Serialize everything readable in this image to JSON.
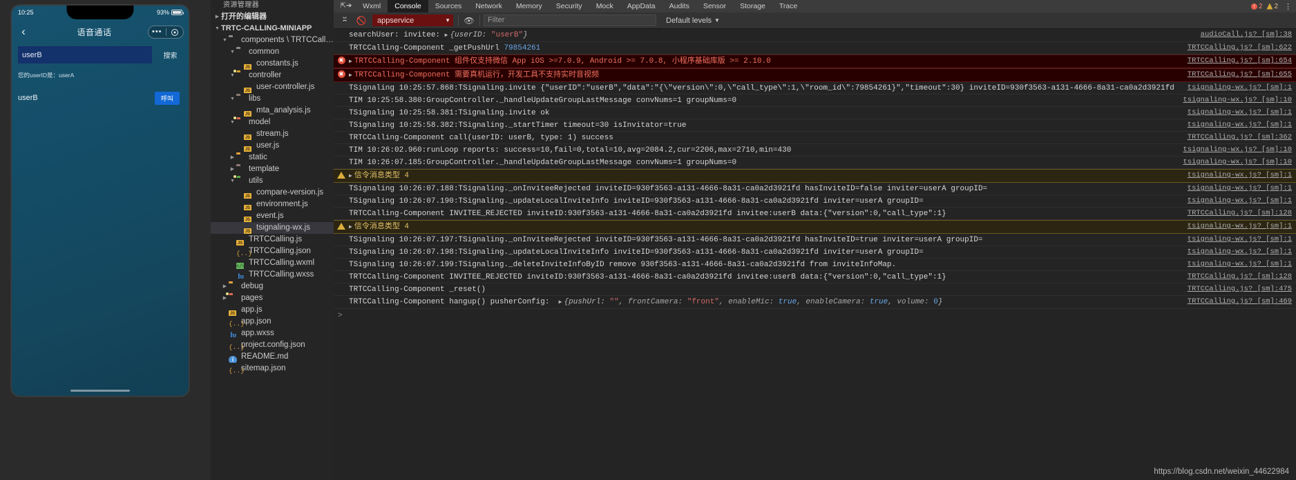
{
  "simulator": {
    "status_time": "10:25",
    "battery_percent": "93%",
    "nav": {
      "back_icon": "chevron-left",
      "title": "语音通话",
      "dots": "•••",
      "capsule_circle": "circle-icon"
    },
    "search": {
      "value": "userB",
      "button_label": "搜索"
    },
    "userid_line": "您的userID是：userA",
    "callee": {
      "name": "userB",
      "call_button_label": "呼叫"
    }
  },
  "explorer": {
    "title": "资源管理器",
    "tree": [
      {
        "indent": 0,
        "twisty": "collapsed",
        "icon": "none",
        "label": "打开的编辑器",
        "bold": true,
        "selected": false
      },
      {
        "indent": 0,
        "twisty": "expanded",
        "icon": "none",
        "label": "TRTC-CALLING-MINIAPP",
        "bold": true,
        "selected": false
      },
      {
        "indent": 1,
        "twisty": "expanded",
        "icon": "folder-gray",
        "label": "components \\ TRTCCalling",
        "selected": false
      },
      {
        "indent": 2,
        "twisty": "expanded",
        "icon": "folder-gray",
        "label": "common",
        "selected": false
      },
      {
        "indent": 3,
        "twisty": "none",
        "icon": "js",
        "label": "constants.js",
        "selected": false
      },
      {
        "indent": 2,
        "twisty": "expanded",
        "icon": "folder-yellow-badge",
        "label": "controller",
        "selected": false
      },
      {
        "indent": 3,
        "twisty": "none",
        "icon": "js",
        "label": "user-controller.js",
        "selected": false
      },
      {
        "indent": 2,
        "twisty": "expanded",
        "icon": "folder-purple",
        "label": "libs",
        "selected": false
      },
      {
        "indent": 3,
        "twisty": "none",
        "icon": "js",
        "label": "mta_analysis.js",
        "selected": false
      },
      {
        "indent": 2,
        "twisty": "expanded",
        "icon": "folder-red-badge",
        "label": "model",
        "selected": false
      },
      {
        "indent": 3,
        "twisty": "none",
        "icon": "js",
        "label": "stream.js",
        "selected": false
      },
      {
        "indent": 3,
        "twisty": "none",
        "icon": "js",
        "label": "user.js",
        "selected": false
      },
      {
        "indent": 2,
        "twisty": "collapsed",
        "icon": "folder-orange",
        "label": "static",
        "selected": false
      },
      {
        "indent": 2,
        "twisty": "collapsed",
        "icon": "folder-purple",
        "label": "template",
        "selected": false
      },
      {
        "indent": 2,
        "twisty": "expanded",
        "icon": "folder-green-badge",
        "label": "utils",
        "selected": false
      },
      {
        "indent": 3,
        "twisty": "none",
        "icon": "js",
        "label": "compare-version.js",
        "selected": false
      },
      {
        "indent": 3,
        "twisty": "none",
        "icon": "js",
        "label": "environment.js",
        "selected": false
      },
      {
        "indent": 3,
        "twisty": "none",
        "icon": "js",
        "label": "event.js",
        "selected": false
      },
      {
        "indent": 3,
        "twisty": "none",
        "icon": "js",
        "label": "tsignaling-wx.js",
        "selected": true
      },
      {
        "indent": 2,
        "twisty": "none",
        "icon": "js",
        "label": "TRTCCalling.js",
        "selected": false
      },
      {
        "indent": 2,
        "twisty": "none",
        "icon": "json",
        "label": "TRTCCalling.json",
        "selected": false
      },
      {
        "indent": 2,
        "twisty": "none",
        "icon": "wxml",
        "label": "TRTCCalling.wxml",
        "selected": false
      },
      {
        "indent": 2,
        "twisty": "none",
        "icon": "wxss",
        "label": "TRTCCalling.wxss",
        "selected": false
      },
      {
        "indent": 1,
        "twisty": "collapsed",
        "icon": "folder-orange",
        "label": "debug",
        "selected": false
      },
      {
        "indent": 1,
        "twisty": "collapsed",
        "icon": "folder-red-badge",
        "label": "pages",
        "selected": false
      },
      {
        "indent": 1,
        "twisty": "none",
        "icon": "js",
        "label": "app.js",
        "selected": false
      },
      {
        "indent": 1,
        "twisty": "none",
        "icon": "json",
        "label": "app.json",
        "selected": false
      },
      {
        "indent": 1,
        "twisty": "none",
        "icon": "wxss",
        "label": "app.wxss",
        "selected": false
      },
      {
        "indent": 1,
        "twisty": "none",
        "icon": "json",
        "label": "project.config.json",
        "selected": false
      },
      {
        "indent": 1,
        "twisty": "none",
        "icon": "md",
        "label": "README.md",
        "selected": false
      },
      {
        "indent": 1,
        "twisty": "none",
        "icon": "json",
        "label": "sitemap.json",
        "selected": false
      }
    ]
  },
  "devtools": {
    "tabs": [
      {
        "label": "Wxml",
        "active": false
      },
      {
        "label": "Console",
        "active": true
      },
      {
        "label": "Sources",
        "active": false
      },
      {
        "label": "Network",
        "active": false
      },
      {
        "label": "Memory",
        "active": false
      },
      {
        "label": "Security",
        "active": false
      },
      {
        "label": "Mock",
        "active": false
      },
      {
        "label": "AppData",
        "active": false
      },
      {
        "label": "Audits",
        "active": false
      },
      {
        "label": "Sensor",
        "active": false
      },
      {
        "label": "Storage",
        "active": false
      },
      {
        "label": "Trace",
        "active": false
      }
    ],
    "error_count": "2",
    "warn_count": "2",
    "kebab": "⋮",
    "toolbar": {
      "sidebar_toggle_icon": "panel-icon",
      "clear_icon": "clear-console-icon",
      "context": "appservice",
      "eye_icon": "eye-icon",
      "filter_placeholder": "Filter",
      "levels_label": "Default levels"
    },
    "console_prompt": ">",
    "logs": [
      {
        "level": "log",
        "source": "audioCall.js? [sm]:38",
        "segments": [
          {
            "t": "searchUser: invitee: "
          },
          {
            "t": "▶",
            "c": "arrow"
          },
          {
            "t": "{userID: ",
            "c": "obj-italic"
          },
          {
            "t": "\"userB\"",
            "c": "str"
          },
          {
            "t": "}",
            "c": "obj-italic"
          }
        ]
      },
      {
        "level": "log",
        "source": "TRTCCalling.js? [sm]:622",
        "segments": [
          {
            "t": "TRTCCalling-Component _getPushUrl "
          },
          {
            "t": "79854261",
            "c": "num"
          }
        ]
      },
      {
        "level": "error",
        "source": "TRTCCalling.js? [sm]:654",
        "segments": [
          {
            "t": "▶",
            "c": "arrow"
          },
          {
            "t": "TRTCCalling-Component 组件仅支持微信 App iOS >=7.0.9, Android >= 7.0.8, 小程序基础库版 >= 2.10.0"
          }
        ]
      },
      {
        "level": "error",
        "source": "TRTCCalling.js? [sm]:655",
        "segments": [
          {
            "t": "▶",
            "c": "arrow"
          },
          {
            "t": "TRTCCalling-Component 需要真机运行，开发工具不支持实时音视频"
          }
        ]
      },
      {
        "level": "log",
        "source": "tsignaling-wx.js? [sm]:1",
        "segments": [
          {
            "t": "TSignaling 10:25:57.868:TSignaling.invite {\"userID\":\"userB\",\"data\":\"{\\\"version\\\":0,\\\"call_type\\\":1,\\\"room_id\\\":79854261}\",\"timeout\":30} inviteID=930f3563-a131-4666-8a31-ca0a2d3921fd"
          }
        ]
      },
      {
        "level": "log",
        "source": "tsignaling-wx.js? [sm]:10",
        "segments": [
          {
            "t": "TIM 10:25:58.380:GroupController._handleUpdateGroupLastMessage convNums=1 groupNums=0"
          }
        ]
      },
      {
        "level": "log",
        "source": "tsignaling-wx.js? [sm]:1",
        "segments": [
          {
            "t": "TSignaling 10:25:58.381:TSignaling.invite ok"
          }
        ]
      },
      {
        "level": "log",
        "source": "tsignaling-wx.js? [sm]:1",
        "segments": [
          {
            "t": "TSignaling 10:25:58.382:TSignaling._startTimer timeout=30 isInvitator=true"
          }
        ]
      },
      {
        "level": "log",
        "source": "TRTCCalling.js? [sm]:362",
        "segments": [
          {
            "t": "TRTCCalling-Component call(userID: userB, type: 1) success"
          }
        ]
      },
      {
        "level": "log",
        "source": "tsignaling-wx.js? [sm]:10",
        "segments": [
          {
            "t": "TIM 10:26:02.960:runLoop reports: success=10,fail=0,total=10,avg=2084.2,cur=2206,max=2710,min=430"
          }
        ]
      },
      {
        "level": "log",
        "source": "tsignaling-wx.js? [sm]:10",
        "segments": [
          {
            "t": "TIM 10:26:07.185:GroupController._handleUpdateGroupLastMessage convNums=1 groupNums=0"
          }
        ]
      },
      {
        "level": "warn",
        "source": "tsignaling-wx.js? [sm]:1",
        "segments": [
          {
            "t": "▶",
            "c": "arrow"
          },
          {
            "t": "信令消息类型 4"
          }
        ]
      },
      {
        "level": "log",
        "source": "tsignaling-wx.js? [sm]:1",
        "segments": [
          {
            "t": "TSignaling 10:26:07.188:TSignaling._onInviteeRejected inviteID=930f3563-a131-4666-8a31-ca0a2d3921fd hasInviteID=false inviter=userA groupID="
          }
        ]
      },
      {
        "level": "log",
        "source": "tsignaling-wx.js? [sm]:1",
        "segments": [
          {
            "t": "TSignaling 10:26:07.190:TSignaling._updateLocalInviteInfo inviteID=930f3563-a131-4666-8a31-ca0a2d3921fd inviter=userA groupID="
          }
        ]
      },
      {
        "level": "log",
        "source": "TRTCCalling.js? [sm]:128",
        "segments": [
          {
            "t": "TRTCCalling-Component INVITEE_REJECTED inviteID:930f3563-a131-4666-8a31-ca0a2d3921fd invitee:userB data:{\"version\":0,\"call_type\":1}"
          }
        ]
      },
      {
        "level": "warn",
        "source": "tsignaling-wx.js? [sm]:1",
        "segments": [
          {
            "t": "▶",
            "c": "arrow"
          },
          {
            "t": "信令消息类型 4"
          }
        ]
      },
      {
        "level": "log",
        "source": "tsignaling-wx.js? [sm]:1",
        "segments": [
          {
            "t": "TSignaling 10:26:07.197:TSignaling._onInviteeRejected inviteID=930f3563-a131-4666-8a31-ca0a2d3921fd hasInviteID=true inviter=userA groupID="
          }
        ]
      },
      {
        "level": "log",
        "source": "tsignaling-wx.js? [sm]:1",
        "segments": [
          {
            "t": "TSignaling 10:26:07.198:TSignaling._updateLocalInviteInfo inviteID=930f3563-a131-4666-8a31-ca0a2d3921fd inviter=userA groupID="
          }
        ]
      },
      {
        "level": "log",
        "source": "tsignaling-wx.js? [sm]:1",
        "segments": [
          {
            "t": "TSignaling 10:26:07.199:TSignaling._deleteInviteInfoByID remove 930f3563-a131-4666-8a31-ca0a2d3921fd from inviteInfoMap."
          }
        ]
      },
      {
        "level": "log",
        "source": "TRTCCalling.js? [sm]:128",
        "segments": [
          {
            "t": "TRTCCalling-Component INVITEE_REJECTED inviteID:930f3563-a131-4666-8a31-ca0a2d3921fd invitee:userB data:{\"version\":0,\"call_type\":1}"
          }
        ]
      },
      {
        "level": "log",
        "source": "TRTCCalling.js? [sm]:475",
        "segments": [
          {
            "t": "TRTCCalling-Component _reset()"
          }
        ]
      },
      {
        "level": "log",
        "source": "TRTCCalling.js? [sm]:469",
        "segments": [
          {
            "t": "TRTCCalling-Component hangup() pusherConfig:  "
          },
          {
            "t": "▶",
            "c": "arrow"
          },
          {
            "t": "{pushUrl: ",
            "c": "obj-italic"
          },
          {
            "t": "\"\"",
            "c": "str"
          },
          {
            "t": ", frontCamera: ",
            "c": "key-italic"
          },
          {
            "t": "\"front\"",
            "c": "str"
          },
          {
            "t": ", enableMic: ",
            "c": "key-italic"
          },
          {
            "t": "true",
            "c": "bool"
          },
          {
            "t": ", enableCamera: ",
            "c": "key-italic"
          },
          {
            "t": "true",
            "c": "bool"
          },
          {
            "t": ", volume: ",
            "c": "key-italic"
          },
          {
            "t": "0",
            "c": "num"
          },
          {
            "t": "}",
            "c": "obj-italic"
          }
        ]
      }
    ]
  },
  "watermark": "https://blog.csdn.net/weixin_44622984"
}
